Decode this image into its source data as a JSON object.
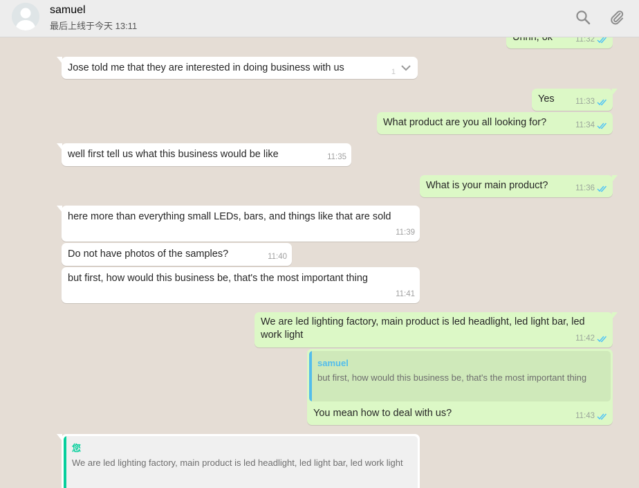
{
  "header": {
    "contact_name": "samuel",
    "last_seen": "最后上线于今天 13:11",
    "icons": [
      "search-icon",
      "attach-icon"
    ]
  },
  "colors": {
    "incoming": "#ffffff",
    "outgoing": "#dcf8c6",
    "read_tick": "#4fc3f7",
    "quote_samuel": "#53bdeb",
    "quote_you": "#06cf9c"
  },
  "messages": [
    {
      "dir": "out",
      "text": "Uhhh, ok",
      "time": "11:32"
    },
    {
      "dir": "in",
      "text": "Jose told me that they are interested in doing business with us",
      "extra": "1"
    },
    {
      "dir": "out",
      "text": "Yes",
      "time": "11:33"
    },
    {
      "dir": "out",
      "text": "What product are you all looking for?",
      "time": "11:34"
    },
    {
      "dir": "in",
      "text": "well first tell us what this business would be like",
      "time": "11:35"
    },
    {
      "dir": "out",
      "text": "What is your main product?",
      "time": "11:36"
    },
    {
      "dir": "in",
      "text": "here more than everything small LEDs, bars, and things like that are sold",
      "time": "11:39"
    },
    {
      "dir": "in",
      "text": "Do not have photos of the samples?",
      "time": "11:40"
    },
    {
      "dir": "in",
      "text": "but first, how would this business be, that's the most important thing",
      "time": "11:41"
    },
    {
      "dir": "out",
      "text": "We are led lighting factory, main product is led headlight, led light bar, led work light",
      "time": "11:42"
    },
    {
      "dir": "out",
      "text": "You mean how to deal with us?",
      "time": "11:43",
      "quote": {
        "name": "samuel",
        "text": "but first, how would this business be, that's the most important thing"
      }
    },
    {
      "dir": "in",
      "text": "",
      "quote": {
        "name": "您",
        "text": "We are led lighting factory, main product is led headlight, led light bar, led work light"
      }
    }
  ]
}
